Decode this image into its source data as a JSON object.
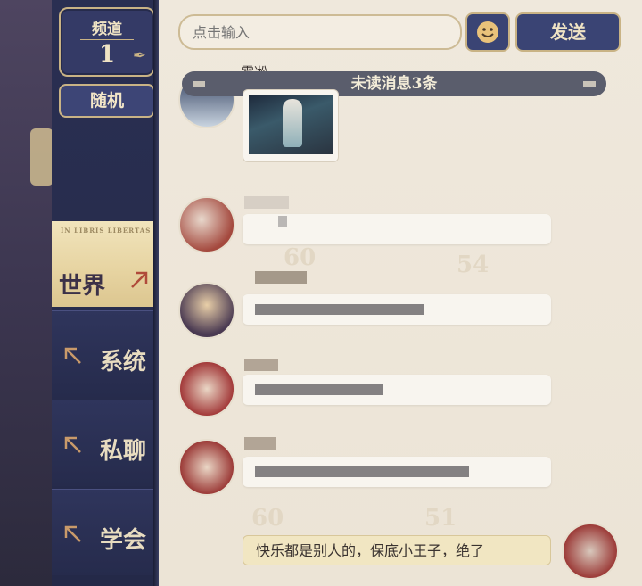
{
  "sidebar": {
    "channel_label": "频道",
    "channel_number": "1",
    "random_label": "随机",
    "tabs": [
      {
        "label": "世界",
        "active": true,
        "tagline": "IN LIBRIS LIBERTAS"
      },
      {
        "label": "系统",
        "active": false
      },
      {
        "label": "私聊",
        "active": false
      },
      {
        "label": "学会",
        "active": false
      }
    ]
  },
  "chat": {
    "input_placeholder": "点击输入",
    "emoji_icon": "smile-icon",
    "send_label": "发送",
    "unread_banner": "未读消息3条",
    "first_sender": "雾凇",
    "self_message": "快乐都是别人的，保底小王子，绝了"
  },
  "colors": {
    "nav_bg": "#2a2f52",
    "accent_gold": "#c9b385",
    "active_tab": "#f1e4bc",
    "panel_bg": "#efe8dc",
    "self_bubble": "#f1e6c2"
  }
}
